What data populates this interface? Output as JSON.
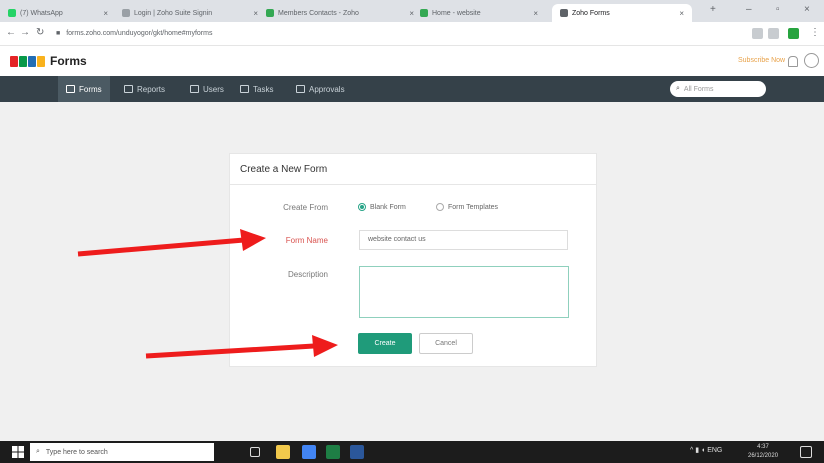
{
  "browser": {
    "tabs": [
      {
        "label": "(7) WhatsApp",
        "active": false
      },
      {
        "label": "Login | Zoho Suite Signin",
        "active": false
      },
      {
        "label": "Members Contacts - Zoho",
        "active": false
      },
      {
        "label": "Home - website",
        "active": false
      },
      {
        "label": "Zoho Forms",
        "active": true
      }
    ],
    "url": "forms.zoho.com/unduyogor/gkt/home#myforms",
    "colors": {
      "tab_active": "#ffffff",
      "tab_strip": "#dee1e6"
    }
  },
  "app": {
    "name": "Forms",
    "logo_letters": [
      "Z",
      "O",
      "H",
      "O"
    ],
    "logo_colors": [
      "#e42527",
      "#089949",
      "#226db4",
      "#f9b21d"
    ],
    "subscribe_label": "Subscribe Now"
  },
  "nav": {
    "items": [
      {
        "label": "Forms",
        "active": true
      },
      {
        "label": "Reports",
        "active": false
      },
      {
        "label": "Users",
        "active": false
      },
      {
        "label": "Tasks",
        "active": false
      },
      {
        "label": "Approvals",
        "active": false
      }
    ],
    "search_placeholder": "All Forms",
    "bg_color": "#354149"
  },
  "dialog": {
    "title": "Create a New Form",
    "create_from_label": "Create From",
    "option_blank": "Blank Form",
    "option_templates": "Form Templates",
    "selected_option": "Blank Form",
    "form_name_label": "Form Name",
    "form_name_value": "website contact us",
    "description_label": "Description",
    "description_value": "",
    "create_label": "Create",
    "cancel_label": "Cancel",
    "accent_color": "#1f9b7a"
  },
  "annotations": {
    "arrow_color": "#ee1c1c",
    "arrows": [
      "points-to-form-name",
      "points-to-create-button"
    ]
  },
  "taskbar": {
    "search_placeholder": "Type here to search",
    "time": "4:37",
    "date": "26/12/2020"
  }
}
